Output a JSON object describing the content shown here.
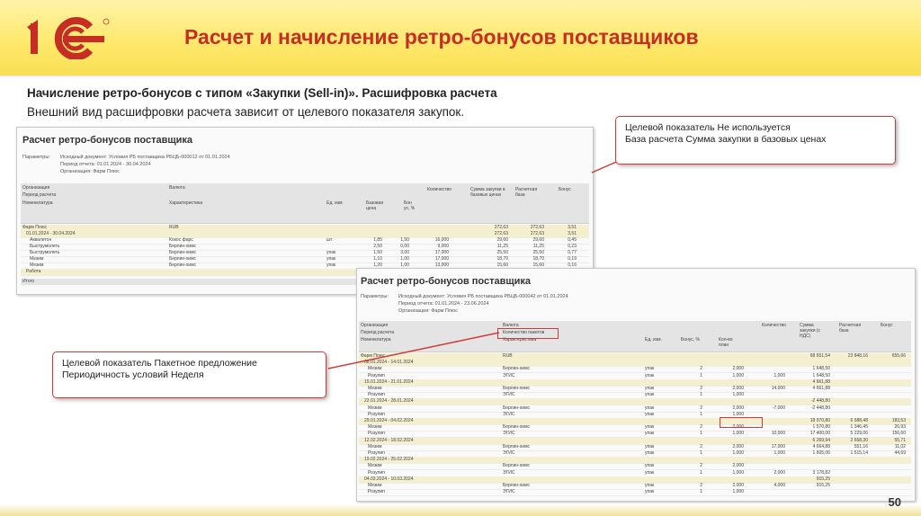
{
  "header": {
    "title": "Расчет и начисление ретро-бонусов поставщиков"
  },
  "subtitle": {
    "line1": "Начисление ретро-бонусов с типом «Закупки (Sell-in)». Расшифровка расчета",
    "line2": "Внешний вид расшифровки расчета зависит от целевого показателя закупок."
  },
  "callout_top": {
    "line1": "Целевой показатель Не используется",
    "line2": "База расчета Сумма закупки в базовых ценах"
  },
  "callout_left": {
    "line1": "Целевой показатель Пакетное предложение",
    "line2": "Периодичность условий Неделя"
  },
  "page_number": "50",
  "colors": {
    "title": "#c62e25",
    "callout_border": "#d23a3a",
    "header_bg": "#ffe869"
  },
  "screen1": {
    "title": "Расчет ретро-бонусов поставщика",
    "params_label": "Параметры:",
    "doc": "Исходный документ: Условия РБ поставщика РБЦБ-000012 от 01.01.2024",
    "period": "Период отчета: 01.01.2024 - 30.04.2024",
    "org": "Организация: Фарм Плюс",
    "hdr": {
      "org": "Организация",
      "currency": "Валюта",
      "period": "Период расчета",
      "nom": "Номенклатура",
      "char": "Характеристика",
      "unit": "Ед. изм",
      "base_price": "Базовая цена",
      "bonus_pct": "Бон ус, %",
      "qty": "Количество",
      "sum": "Сумма закупки в базовых ценах",
      "calc_base": "Расчетная база",
      "bonus": "Бонус"
    },
    "rows": [
      [
        "Фарм Плюс",
        "RUB",
        "",
        "",
        "",
        "",
        "",
        "272,63",
        "272,63",
        "3,51"
      ],
      [
        "01.01.2024 - 30.04.2024",
        "",
        "",
        "",
        "",
        "",
        "",
        "272,63",
        "272,63",
        "3,51"
      ],
      [
        "Аквалетон",
        "Кокос фарс",
        "шт",
        "1,85",
        "1,50",
        "16,000",
        "",
        "29,60",
        "29,60",
        "0,45"
      ],
      [
        "Быструмолеть",
        "Берлин-химс",
        "",
        "2,50",
        "0,00",
        "9,000",
        "",
        "11,25",
        "11,25",
        "0,23"
      ],
      [
        "Быструмолеть",
        "Берлин-химс",
        "упак",
        "1,50",
        "3,00",
        "17,000",
        "",
        "25,50",
        "25,50",
        "0,77"
      ],
      [
        "Мезим",
        "Берлин-химс",
        "упак",
        "1,10",
        "1,00",
        "17,000",
        "",
        "18,70",
        "18,70",
        "0,19"
      ],
      [
        "Мезим",
        "Берлин-химс",
        "упак",
        "1,20",
        "1,00",
        "13,000",
        "",
        "15,60",
        "15,60",
        "0,16"
      ],
      [
        "Работа",
        "",
        "",
        "",
        "",
        "",
        "",
        "",
        "",
        ""
      ]
    ],
    "total_label": "Итого"
  },
  "screen2": {
    "title": "Расчет ретро-бонусов поставщика",
    "params_label": "Параметры:",
    "doc": "Исходный документ: Условия РБ поставщика РБЦБ-000042 от 01.01.2024",
    "period": "Период отчета: 01.01.2024 - 23.06.2024",
    "org": "Организация: Фарм Плюс",
    "hdr": {
      "org": "Организация",
      "currency": "Валюта",
      "period": "Период расчета",
      "package": "Количество пакетов",
      "nom": "Номенклатура",
      "char": "Характеристика",
      "unit": "Ед. изм.",
      "bonus_pct": "Бонус, %",
      "qty_plan": "Кол-во план",
      "qty": "Количество",
      "sum": "Сумма закупки (с НДС)",
      "calc_base": "Расчетная база",
      "bonus": "Бонус"
    },
    "rows": [
      [
        "Фарм Плюс",
        "RUB",
        "",
        "",
        "",
        "",
        "",
        "68 651,54",
        "23 848,16",
        "655,66"
      ],
      [
        "08.01.2024 - 14.01.2024",
        "",
        "",
        "",
        "",
        "",
        "",
        "",
        "",
        ""
      ],
      [
        "Мезим",
        "Берлин-химс",
        "упак",
        "2",
        "2,000",
        "",
        "",
        "1 648,50",
        "",
        ""
      ],
      [
        "Розулип",
        "ЭГИС",
        "упак",
        "1",
        "1,000",
        "1,000",
        "",
        "1 648,50",
        "",
        ""
      ],
      [
        "15.01.2024 - 21.01.2024",
        "",
        "",
        "",
        "",
        "",
        "",
        "4 661,88",
        "",
        ""
      ],
      [
        "Мезим",
        "Берлин-химс",
        "упак",
        "2",
        "2,000",
        "14,000",
        "",
        "4 661,88",
        "",
        ""
      ],
      [
        "Розулип",
        "ЭГИС",
        "упак",
        "1",
        "1,000",
        "",
        "",
        "",
        "",
        ""
      ],
      [
        "22.01.2024 - 28.01.2024",
        "",
        "",
        "",
        "",
        "",
        "",
        "-2 448,80",
        "",
        ""
      ],
      [
        "Мезим",
        "Берлин-химс",
        "упак",
        "2",
        "2,000",
        "-7,000",
        "",
        "-2 448,80",
        "",
        ""
      ],
      [
        "Розулип",
        "ЭГИС",
        "упак",
        "1",
        "1,000",
        "",
        "",
        "",
        "",
        ""
      ],
      [
        "29.01.2024 - 04.02.2024",
        "",
        "",
        "",
        "",
        "",
        "",
        "18 970,80",
        "6 588,48",
        "183,53"
      ],
      [
        "Мезим",
        "Берлин-химс",
        "упак",
        "2",
        "2,000",
        "",
        "",
        "1 570,80",
        "1 346,45",
        "26,93"
      ],
      [
        "Розулип",
        "ЭГИС",
        "упак",
        "1",
        "1,000",
        "10,000",
        "",
        "17 400,00",
        "5 229,06",
        "156,60"
      ],
      [
        "12.02.2024 - 18.02.2024",
        "",
        "",
        "",
        "",
        "",
        "",
        "6 269,94",
        "2 668,30",
        "55,71"
      ],
      [
        "Мезим",
        "Берлин-химс",
        "упак",
        "2",
        "2,000",
        "17,000",
        "",
        "4 664,88",
        "551,16",
        "11,02"
      ],
      [
        "Розулип",
        "ЭГИС",
        "упак",
        "1",
        "1,000",
        "1,000",
        "",
        "1 605,06",
        "1 515,14",
        "44,69"
      ],
      [
        "19.02.2024 - 25.02.2024",
        "",
        "",
        "",
        "",
        "",
        "",
        "",
        "",
        ""
      ],
      [
        "Мезим",
        "Берлин-химс",
        "упак",
        "2",
        "2,000",
        "",
        "",
        "",
        "",
        ""
      ],
      [
        "Розулип",
        "ЭГИС",
        "упак",
        "1",
        "1,000",
        "2,000",
        "",
        "3 178,82",
        "",
        ""
      ],
      [
        "04.03.2024 - 10.03.2024",
        "",
        "",
        "",
        "",
        "",
        "",
        "915,25",
        "",
        ""
      ],
      [
        "Мезим",
        "Берлин-химс",
        "упак",
        "2",
        "2,000",
        "4,000",
        "",
        "915,25",
        "",
        ""
      ],
      [
        "Розулип",
        "ЭГИС",
        "упак",
        "1",
        "1,000",
        "",
        "",
        "",
        "",
        ""
      ]
    ]
  }
}
